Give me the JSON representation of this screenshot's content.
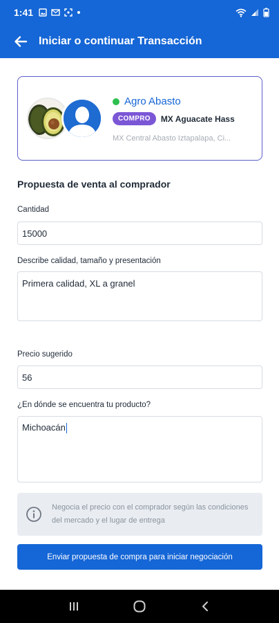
{
  "status_bar": {
    "time": "1:41"
  },
  "app_bar": {
    "title": "Iniciar o continuar Transacción"
  },
  "vendor": {
    "name": "Agro Abasto",
    "badge": "COMPRO",
    "product": "MX Aguacate Hass",
    "location": "MX Central Abasto Iztapalapa, Ci..."
  },
  "form": {
    "section_title": "Propuesta de venta al comprador",
    "quantity_label": "Cantidad",
    "quantity_value": "15000",
    "description_label": "Describe calidad, tamaño y presentación",
    "description_value": "Primera calidad, XL a granel",
    "price_label": "Precio sugerido",
    "price_value": "56",
    "location_label": "¿En dónde se encuentra tu producto?",
    "location_value": "Michoacán"
  },
  "info": {
    "text": "Negocia el precio con el comprador según las condiciones del mercado y el lugar de entrega"
  },
  "submit": {
    "label": "Enviar propuesta de compra para iniciar negociación"
  },
  "colors": {
    "primary": "#1566d6",
    "badge": "#7b57d6",
    "online": "#2fbf4f",
    "card_border": "#5b5fc7"
  },
  "icons": {
    "back": "arrow-left-icon",
    "info": "info-icon",
    "nav_recents": "recents-icon",
    "nav_home": "home-icon",
    "nav_back": "chevron-left-icon"
  }
}
